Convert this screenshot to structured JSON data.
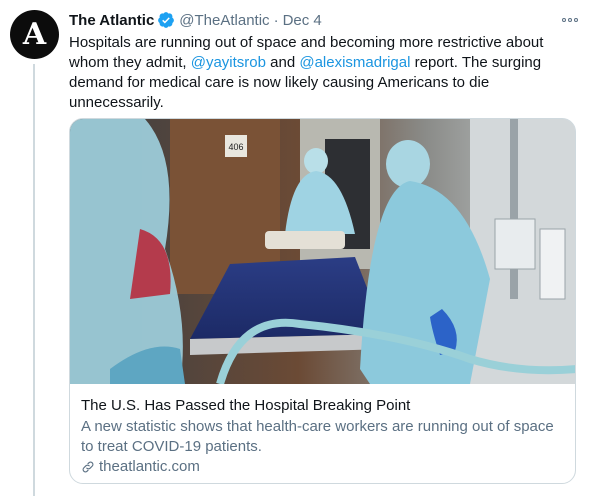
{
  "tweet": {
    "avatar_letter": "A",
    "author_name": "The Atlantic",
    "handle": "@TheAtlantic",
    "separator": "·",
    "date": "Dec 4",
    "text_part1": "Hospitals are running out of space and becoming more restrictive about whom they admit, ",
    "mention1": "@yayitsrob",
    "text_and": " and ",
    "mention2": "@alexismadrigal",
    "text_part2": " report. The surging demand for medical care is now likely causing Americans to die unnecessarily.",
    "room_sign": "406"
  },
  "card": {
    "title": "The U.S. Has Passed the Hospital Breaking Point",
    "description": "A new statistic shows that health-care workers are running out of space to treat COVID-19 patients.",
    "domain": "theatlantic.com"
  },
  "colors": {
    "link": "#1b95e0",
    "muted": "#5b7083",
    "verified": "#1da1f2",
    "border": "#cfd9de"
  },
  "icons": [
    "verified-badge-icon",
    "more-options-icon",
    "link-icon"
  ]
}
